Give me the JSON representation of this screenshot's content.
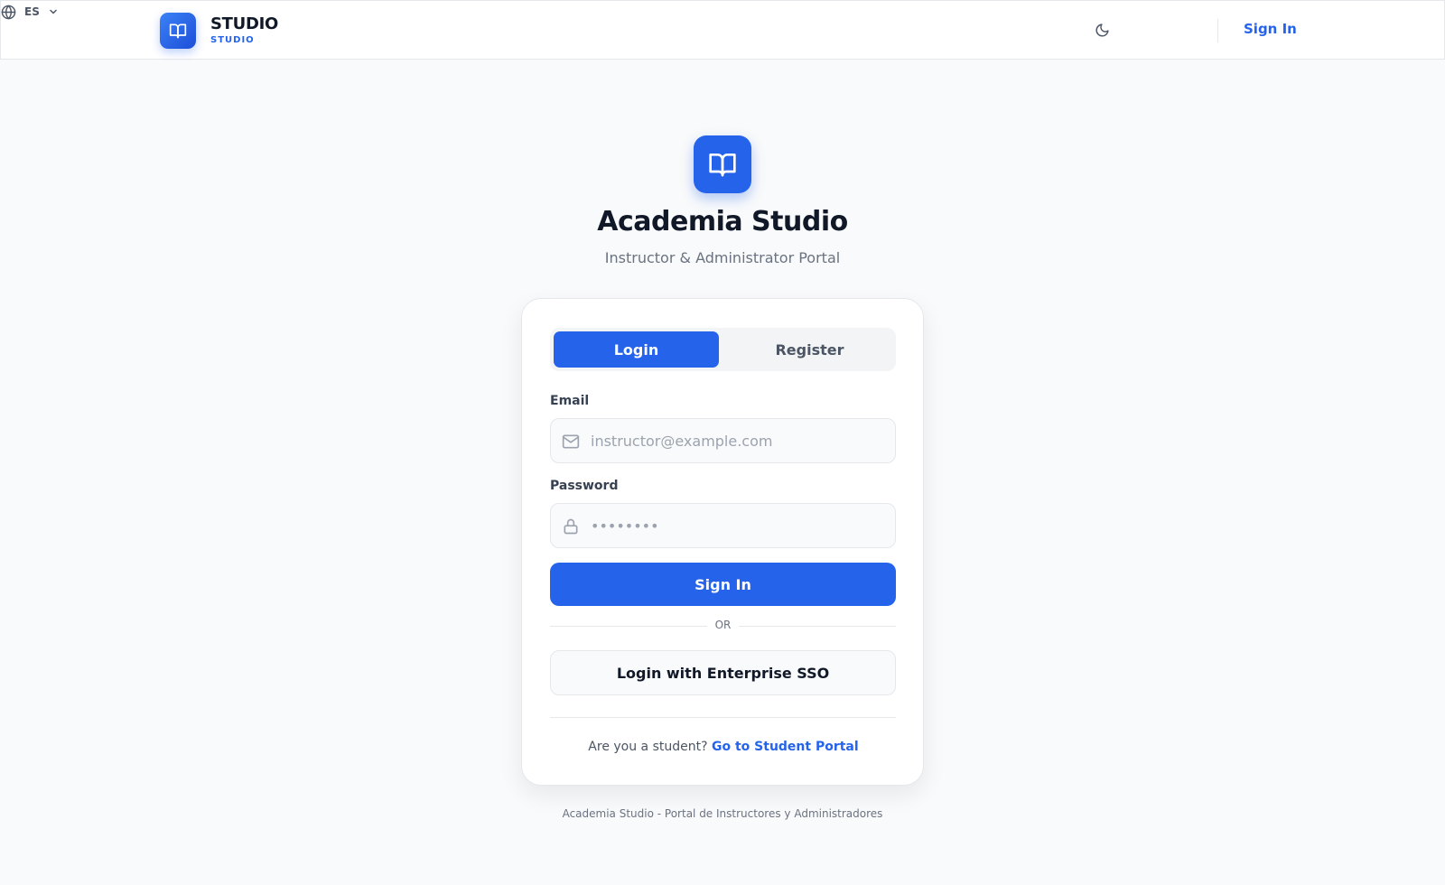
{
  "colors": {
    "accent": "#2563eb",
    "background": "#f9fafb",
    "card": "#ffffff"
  },
  "header": {
    "brand_title": "STUDIO",
    "brand_subtitle": "STUDIO",
    "brand_icon": "book-open-icon",
    "theme_icon": "moon-icon",
    "language_icon": "globe-icon",
    "language": "ES",
    "sign_in_label": "Sign In"
  },
  "hero": {
    "icon": "book-open-icon",
    "title": "Academia Studio",
    "subtitle": "Instructor & Administrator Portal"
  },
  "auth": {
    "tabs": [
      {
        "label": "Login",
        "active": true
      },
      {
        "label": "Register",
        "active": false
      }
    ],
    "email": {
      "label": "Email",
      "placeholder": "instructor@example.com",
      "value": "",
      "icon": "mail-icon"
    },
    "password": {
      "label": "Password",
      "placeholder": "••••••••",
      "value": "",
      "icon": "lock-icon"
    },
    "submit_label": "Sign In",
    "divider_text": "OR",
    "sso_label": "Login with Enterprise SSO",
    "student_prompt": "Are you a student?",
    "student_link": "Go to Student Portal"
  },
  "footer": {
    "text": "Academia Studio - Portal de Instructores y Administradores"
  }
}
